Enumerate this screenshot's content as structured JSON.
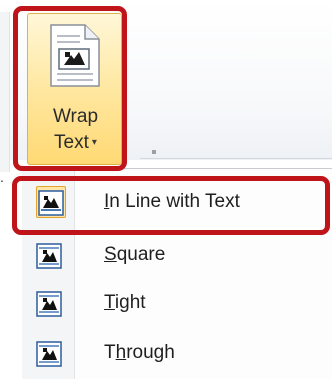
{
  "ribbon": {
    "wrap_text_button": {
      "label_line1": "Wrap",
      "label_line2": "Text",
      "arrow": "▾",
      "icon": "wrap-text-icon"
    }
  },
  "menu": {
    "items": [
      {
        "pre": "",
        "key": "I",
        "post": "n Line with Text",
        "icon": "wrap-in-line-icon",
        "selected": true
      },
      {
        "pre": "",
        "key": "S",
        "post": "quare",
        "icon": "wrap-square-icon",
        "selected": false
      },
      {
        "pre": "",
        "key": "T",
        "post": "ight",
        "icon": "wrap-tight-icon",
        "selected": false
      },
      {
        "pre": "T",
        "key": "h",
        "post": "rough",
        "icon": "wrap-through-icon",
        "selected": false
      }
    ]
  },
  "colors": {
    "highlight": "#c0141b",
    "button_active": "#ffd974",
    "selected_item_bg": "#fde6a7"
  }
}
